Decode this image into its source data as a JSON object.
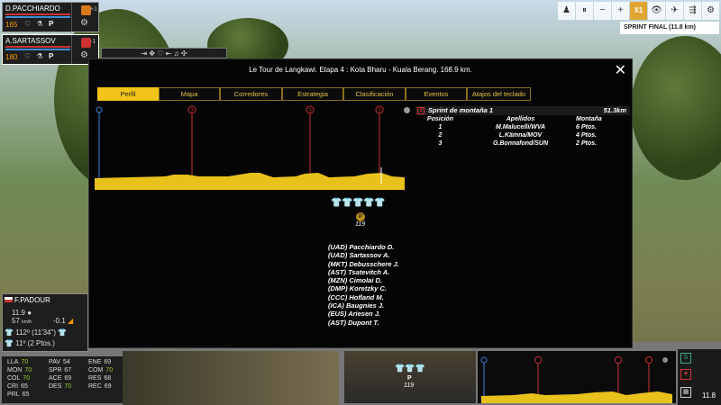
{
  "riders": [
    {
      "name": "D.PACCHIARDO",
      "energy": "165",
      "gap": "+1"
    },
    {
      "name": "A.SARTASSOV",
      "energy": "180",
      "gap": "-1"
    }
  ],
  "command_icons": "⇥ ✥ ♡ ⇤ ♫ ✣",
  "top_controls": [
    "♟",
    "⏸",
    "−",
    "+",
    "X1",
    "👁",
    "✈",
    "⇶",
    "⚙"
  ],
  "sprint_final": "SPRINT FINAL (11.8 km)",
  "dialog": {
    "title": "Le Tour de Langkawi. Etapa 4 : Kota Bharu - Kuala Berang. 168.9 km.",
    "close": "✕",
    "tabs": [
      "Perfil",
      "Mapa",
      "Corredores",
      "Estrategia",
      "Clasificación",
      "Eventos",
      "Atajos del teclado"
    ]
  },
  "profile": {
    "markers": [
      "3",
      "3",
      "3"
    ],
    "p_marker": "P",
    "p_number": "119"
  },
  "leading_group": [
    "(UAD) Pacchiardo D.",
    "(UAD) Sartassov A.",
    "(MKT) Debusschere J.",
    "(AST) Tsatevitch A.",
    "(MZN) Cimolai D.",
    "(DMP) Koretzky C.",
    "(CCC) Hofland M.",
    "(ICA) Baugnies J.",
    "(EUS) Ariesen J.",
    "(AST) Dupont T."
  ],
  "sprint": {
    "icon": "3",
    "title": "Sprint de montaña 1",
    "distance": "51.3km",
    "headers": [
      "Posición",
      "Apellidos",
      "Montaña"
    ],
    "rows": [
      [
        "1",
        "M.Malucelli/WVA",
        "6 Ptos."
      ],
      [
        "2",
        "L.Kämna/MOV",
        "4 Ptos."
      ],
      [
        "3",
        "G.Bonnafond/SUN",
        "2 Ptos."
      ]
    ]
  },
  "follow_rider": {
    "name": "F.PADOUR",
    "speed": "11.9",
    "kmh": "57",
    "kmh_unit": "km/h",
    "gradient": "-0.1",
    "yellow_rank": "112º (11'34\")",
    "other_rank": "11º (2 Ptos.)"
  },
  "stats": [
    [
      "LLA",
      "70"
    ],
    [
      "PAV",
      "54"
    ],
    [
      "ENE",
      "69"
    ],
    [
      "MON",
      "70"
    ],
    [
      "SPR",
      "67"
    ],
    [
      "COM",
      "70"
    ],
    [
      "COL",
      "70"
    ],
    [
      "ACE",
      "69"
    ],
    [
      "RES",
      "68"
    ],
    [
      "CRI",
      "65"
    ],
    [
      "DES",
      "70"
    ],
    [
      "REC",
      "69"
    ],
    [
      "PRL",
      "65"
    ]
  ],
  "remaining_km": "11.8",
  "colors": {
    "accent": "#f2c318",
    "mountain": "#cc3333",
    "profile_fill": "#e8c11a"
  }
}
